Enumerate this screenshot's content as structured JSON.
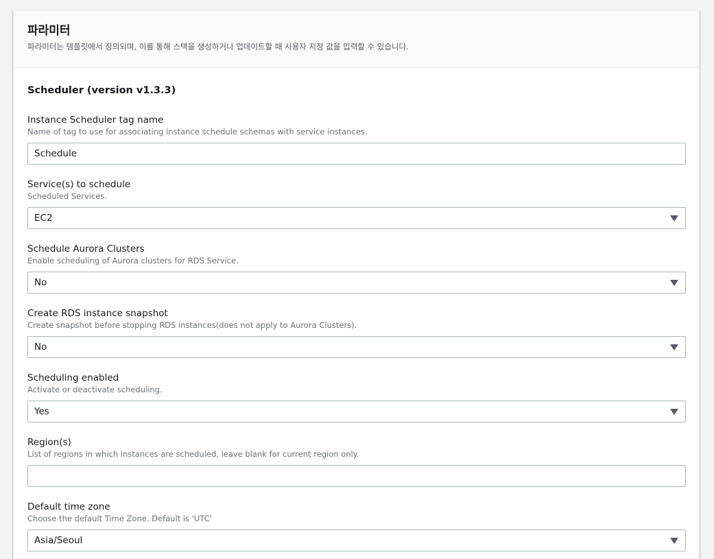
{
  "header": {
    "title": "파라미터",
    "description": "파라미터는 템플릿에서 정의되며, 이를 통해 스택을 생성하거나 업데이트할 때 사용자 지정 값을 입력할 수 있습니다."
  },
  "section": {
    "title": "Scheduler (version v1.3.3)"
  },
  "fields": [
    {
      "label": "Instance Scheduler tag name",
      "description": "Name of tag to use for associating instance schedule schemas with service instances.",
      "value": "Schedule",
      "kind": "text"
    },
    {
      "label": "Service(s) to schedule",
      "description": "Scheduled Services.",
      "value": "EC2",
      "kind": "select"
    },
    {
      "label": "Schedule Aurora Clusters",
      "description": "Enable scheduling of Aurora clusters for RDS Service.",
      "value": "No",
      "kind": "select"
    },
    {
      "label": "Create RDS instance snapshot",
      "description": "Create snapshot before stopping RDS instances(does not apply to Aurora Clusters).",
      "value": "No",
      "kind": "select"
    },
    {
      "label": "Scheduling enabled",
      "description": "Activate or deactivate scheduling.",
      "value": "Yes",
      "kind": "select"
    },
    {
      "label": "Region(s)",
      "description": "List of regions in which instances are scheduled, leave blank for current region only.",
      "value": "",
      "kind": "text"
    },
    {
      "label": "Default time zone",
      "description": "Choose the default Time Zone. Default is 'UTC'",
      "value": "Asia/Seoul",
      "kind": "select"
    }
  ]
}
